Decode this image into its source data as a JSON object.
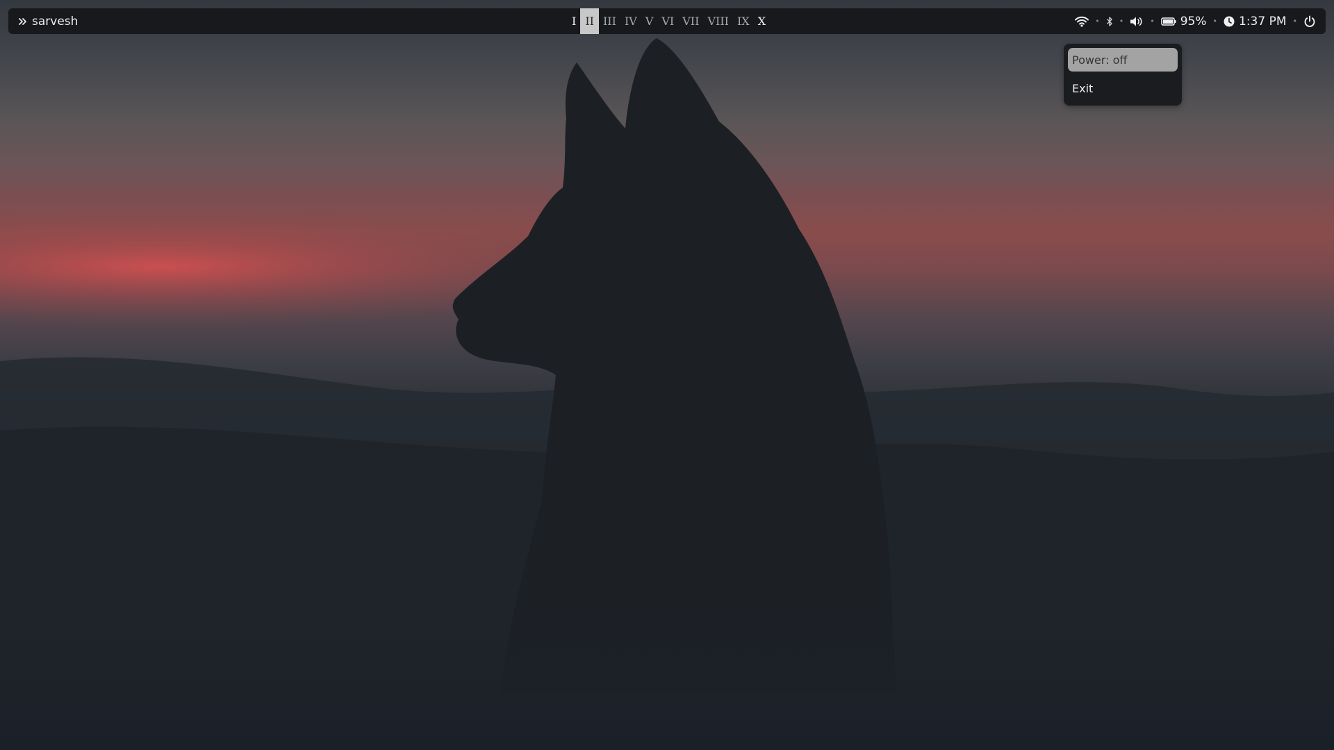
{
  "launcher": {
    "icon": "chevrons-right-icon",
    "user_label": "sarvesh"
  },
  "workspaces": [
    {
      "label": "I",
      "state": "occupied"
    },
    {
      "label": "II",
      "state": "active"
    },
    {
      "label": "III",
      "state": "empty"
    },
    {
      "label": "IV",
      "state": "empty"
    },
    {
      "label": "V",
      "state": "empty"
    },
    {
      "label": "VI",
      "state": "empty"
    },
    {
      "label": "VII",
      "state": "empty"
    },
    {
      "label": "VIII",
      "state": "empty"
    },
    {
      "label": "IX",
      "state": "empty"
    },
    {
      "label": "X",
      "state": "occupied"
    }
  ],
  "tray": {
    "wifi_icon": "wifi-icon",
    "bluetooth_icon": "bluetooth-icon",
    "volume_icon": "volume-icon",
    "battery_icon": "battery-icon",
    "battery_percent": "95%",
    "clock_icon": "clock-icon",
    "time": "1:37 PM",
    "power_icon": "power-icon",
    "separator": "•"
  },
  "power_menu": {
    "items": [
      {
        "label": "Power: off",
        "selected": true
      },
      {
        "label": "Exit",
        "selected": false
      }
    ]
  },
  "colors": {
    "bar_background": "#17191c",
    "workspace_active_bg": "#c8c8c8",
    "menu_selected_bg": "#a3a3a3"
  }
}
